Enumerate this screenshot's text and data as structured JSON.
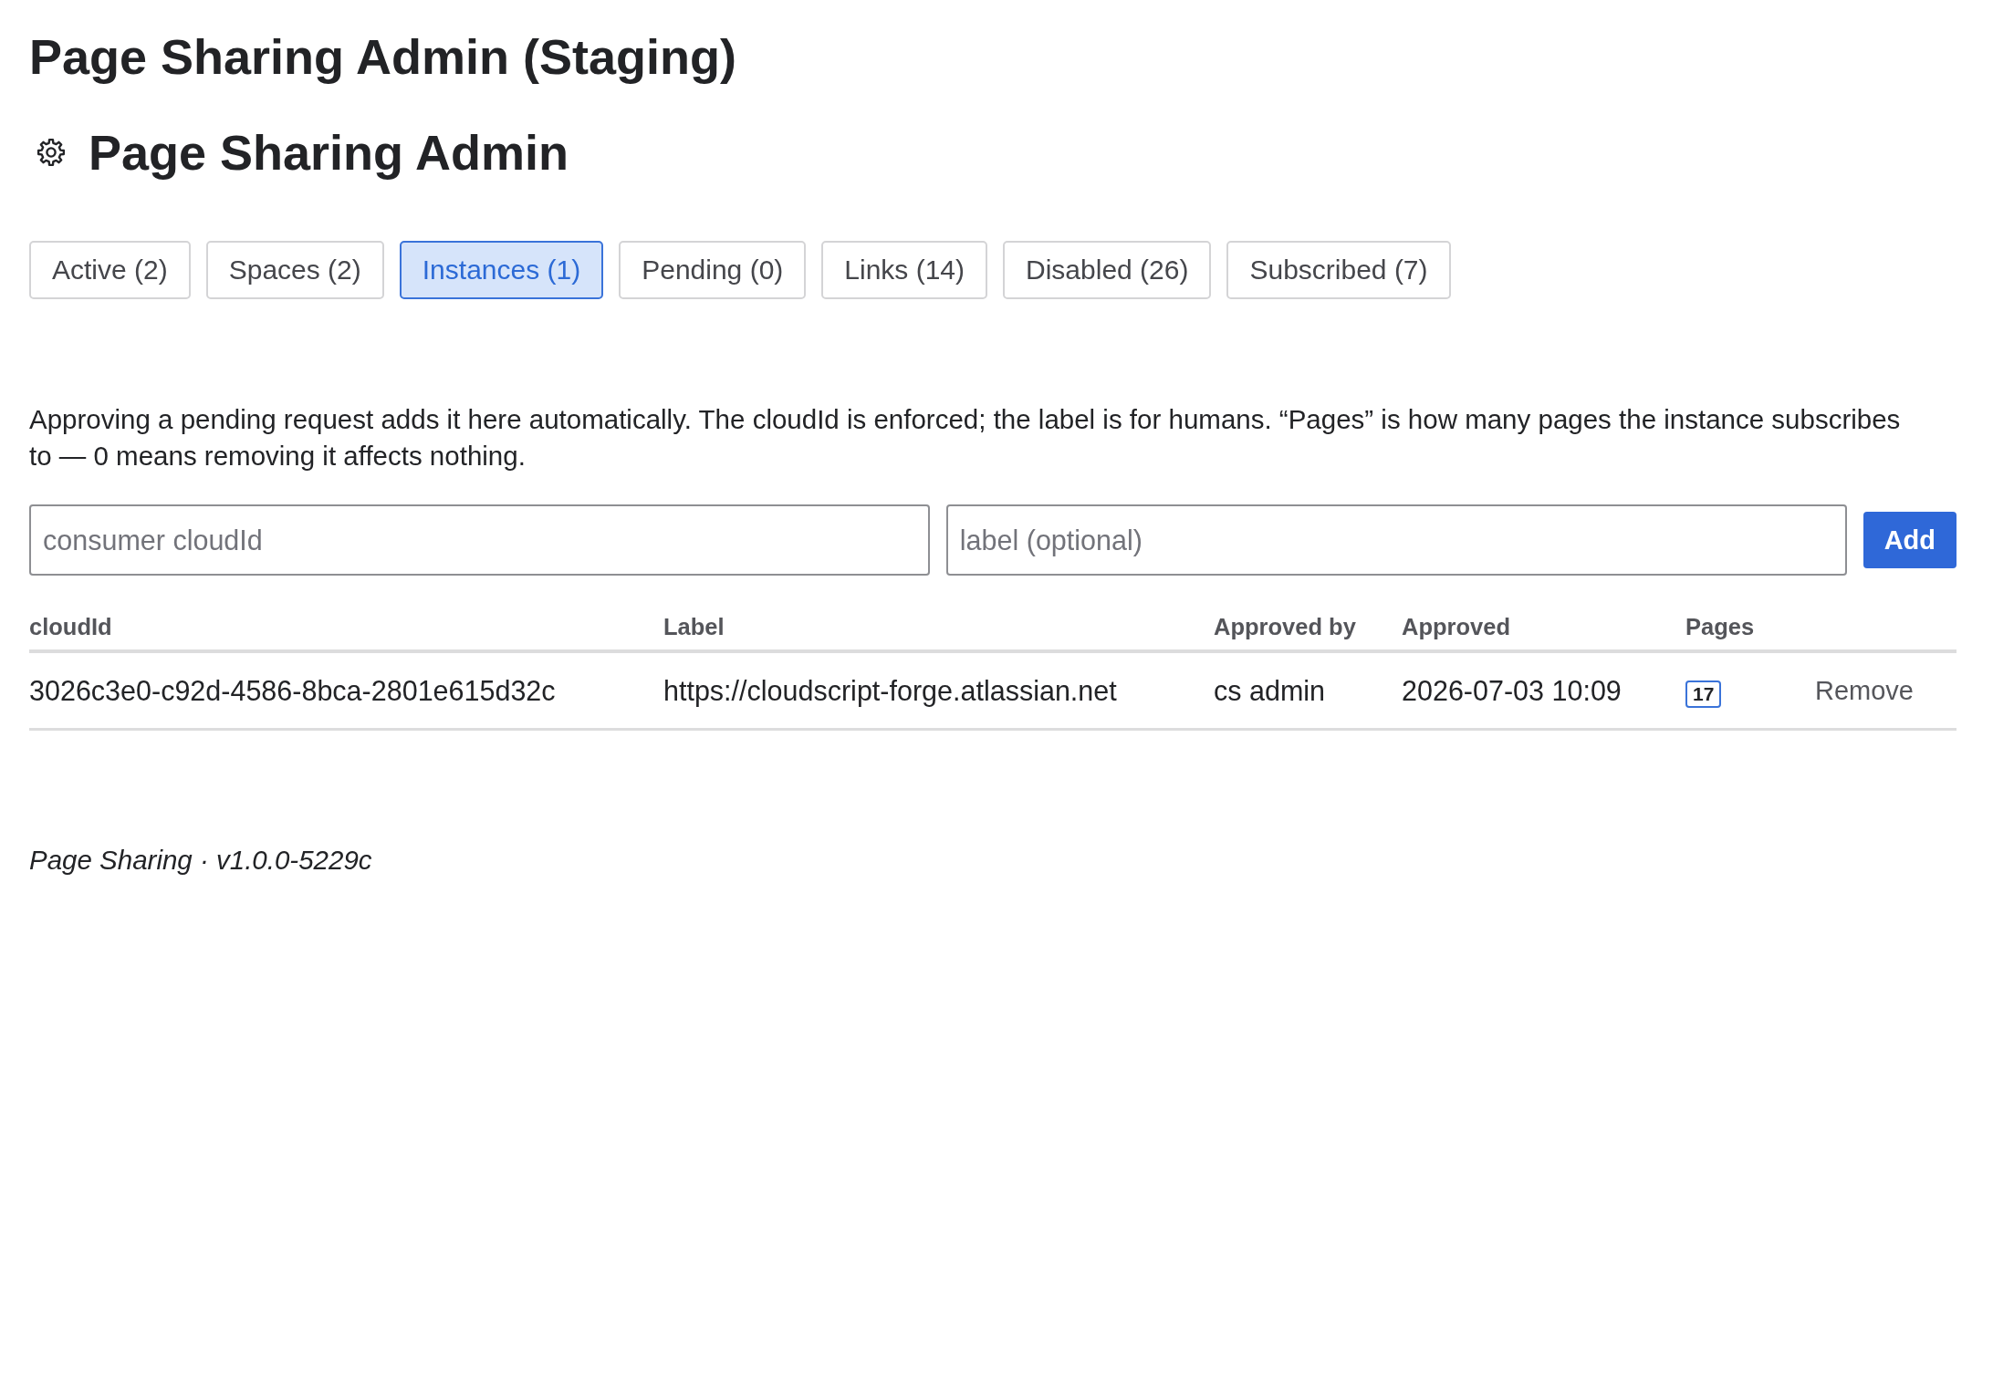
{
  "page_title": "Page Sharing Admin (Staging)",
  "app_header": {
    "title": "Page Sharing Admin"
  },
  "tabs": [
    {
      "label": "Active (2)",
      "selected": false
    },
    {
      "label": "Spaces (2)",
      "selected": false
    },
    {
      "label": "Instances (1)",
      "selected": true
    },
    {
      "label": "Pending (0)",
      "selected": false
    },
    {
      "label": "Links (14)",
      "selected": false
    },
    {
      "label": "Disabled (26)",
      "selected": false
    },
    {
      "label": "Subscribed (7)",
      "selected": false
    }
  ],
  "instances": {
    "description": "Approving a pending request adds it here automatically. The cloudId is enforced; the label is for humans. “Pages” is how many pages the instance subscribes to — 0 means removing it affects nothing.",
    "add_form": {
      "cloud_id_field": {
        "placeholder": "consumer cloudId"
      },
      "label_field": {
        "placeholder": "label (optional)"
      },
      "add_button": "Add"
    },
    "table": {
      "columns": [
        "cloudId",
        "Label",
        "Approved by",
        "Approved",
        "Pages"
      ],
      "rows": [
        {
          "cloud_id": "3026c3e0-c92d-4586-8bca-2801e615d32c",
          "label": "https://cloudscript-forge.atlassian.net",
          "approved_by": "cs admin",
          "approved": "2026-07-03 10:09",
          "pages": "17",
          "action": "Remove"
        }
      ]
    }
  },
  "footer": "Page Sharing · v1.0.0-5229c"
}
